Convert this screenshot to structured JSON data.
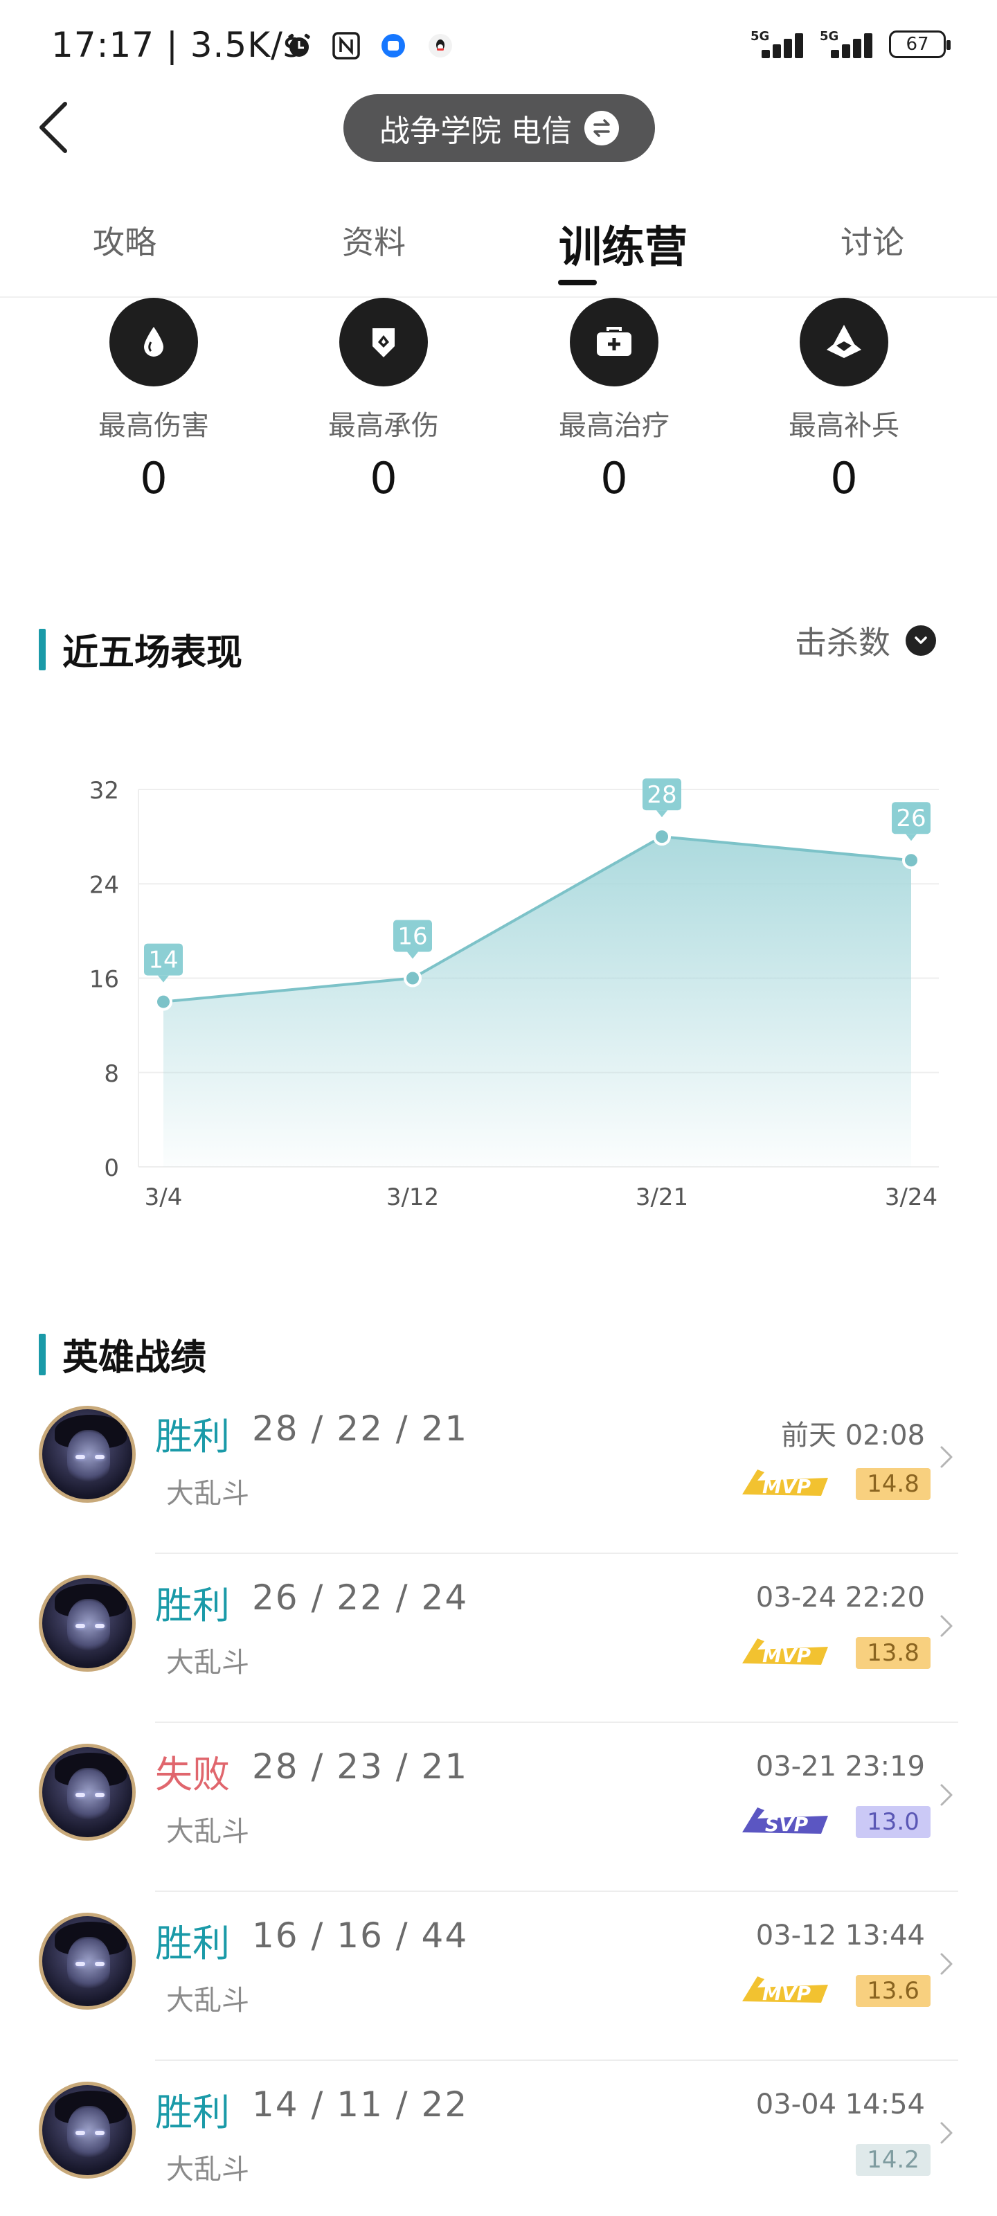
{
  "status_bar": {
    "time": "17:17 | 3.5K/s",
    "signal_1_label": "5G",
    "signal_2_label": "5G",
    "battery": "67",
    "icons": [
      "alarm-icon",
      "nfc-icon",
      "app-notification-icon",
      "qq-icon"
    ]
  },
  "header": {
    "server": "战争学院 电信"
  },
  "tabs": [
    {
      "label": "攻略"
    },
    {
      "label": "资料"
    },
    {
      "label": "训练营",
      "active": true
    },
    {
      "label": "讨论"
    }
  ],
  "stats": [
    {
      "label": "最高伤害",
      "value": "0",
      "icon": "droplet-icon"
    },
    {
      "label": "最高承伤",
      "value": "0",
      "icon": "shield-icon"
    },
    {
      "label": "最高治疗",
      "value": "0",
      "icon": "medkit-icon"
    },
    {
      "label": "最高补兵",
      "value": "0",
      "icon": "minion-icon"
    }
  ],
  "performance": {
    "title": "近五场表现",
    "metric": "击杀数"
  },
  "chart_data": {
    "type": "area",
    "categories": [
      "3/4",
      "3/12",
      "3/21",
      "3/24"
    ],
    "values": [
      14,
      16,
      28,
      26
    ],
    "ylim": [
      0,
      32
    ],
    "yticks": [
      0,
      8,
      16,
      24,
      32
    ],
    "grid": true,
    "data_labels": true,
    "colors": {
      "line": "#7cc2c8",
      "fill_top": "#a8d8dc",
      "label_bg": "#8ccfd4"
    }
  },
  "matches_section": {
    "title": "英雄战绩"
  },
  "matches": [
    {
      "result": "胜利",
      "result_type": "win",
      "kda": "28 / 22 / 21",
      "mode": "大乱斗",
      "time": "前天 02:08",
      "medal": "MVP",
      "medal_color": "#f2c230",
      "score": "14.8",
      "score_style": "gold"
    },
    {
      "result": "胜利",
      "result_type": "win",
      "kda": "26 / 22 / 24",
      "mode": "大乱斗",
      "time": "03-24 22:20",
      "medal": "MVP",
      "medal_color": "#f2c230",
      "score": "13.8",
      "score_style": "gold"
    },
    {
      "result": "失败",
      "result_type": "loss",
      "kda": "28 / 23 / 21",
      "mode": "大乱斗",
      "time": "03-21 23:19",
      "medal": "SVP",
      "medal_color": "#5b56c2",
      "score": "13.0",
      "score_style": "purple"
    },
    {
      "result": "胜利",
      "result_type": "win",
      "kda": "16 / 16 / 44",
      "mode": "大乱斗",
      "time": "03-12 13:44",
      "medal": "MVP",
      "medal_color": "#f2c230",
      "score": "13.6",
      "score_style": "gold"
    },
    {
      "result": "胜利",
      "result_type": "win",
      "kda": "14 / 11 / 22",
      "mode": "大乱斗",
      "time": "03-04 14:54",
      "medal": "",
      "medal_color": "",
      "score": "14.2",
      "score_style": "plain"
    }
  ]
}
